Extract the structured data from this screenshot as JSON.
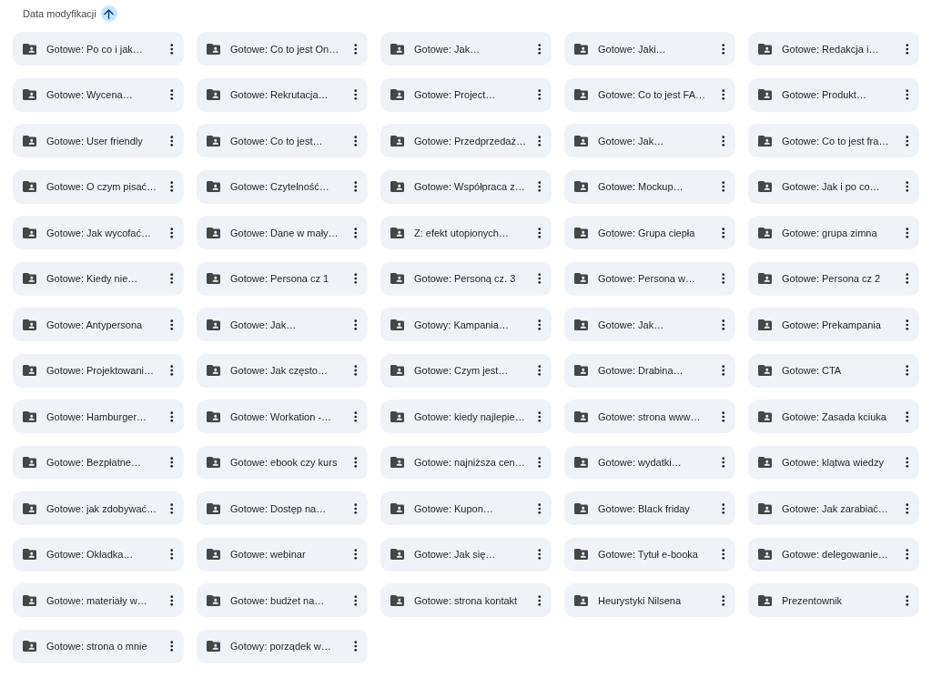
{
  "sort": {
    "label": "Data modyfikacji",
    "ascending": true
  },
  "folders": [
    {
      "name": "Gotowe: Po co i jak…"
    },
    {
      "name": "Gotowe: Co to jest On…"
    },
    {
      "name": "Gotowe: Jak…"
    },
    {
      "name": "Gotowe: Jaki…"
    },
    {
      "name": "Gotowe: Redakcja i…"
    },
    {
      "name": "Gotowe: Wycena…"
    },
    {
      "name": "Gotowe: Rekrutacja…"
    },
    {
      "name": "Gotowe: Project…"
    },
    {
      "name": "Gotowe: Co to jest FA…"
    },
    {
      "name": "Gotowe: Produkt…"
    },
    {
      "name": "Gotowe: User friendly"
    },
    {
      "name": "Gotowe: Co to jest…"
    },
    {
      "name": "Gotowe: Przedprzedaż…"
    },
    {
      "name": "Gotowe: Jak…"
    },
    {
      "name": "Gotowe: Co to jest fra…"
    },
    {
      "name": "Gotowe: O czym pisać…"
    },
    {
      "name": "Gotowe: Czytelność…"
    },
    {
      "name": "Gotowe: Współpraca z…"
    },
    {
      "name": "Gotowe: Mockup…"
    },
    {
      "name": "Gotowe: Jak i po co…"
    },
    {
      "name": "Gotowe: Jak wycofać…"
    },
    {
      "name": "Gotowe: Dane w mały…"
    },
    {
      "name": "Z: efekt utopionych…"
    },
    {
      "name": "Gotowe: Grupa ciepła"
    },
    {
      "name": "Gotowe: grupa zimna"
    },
    {
      "name": "Gotowe: Kiedy nie…"
    },
    {
      "name": "Gotowe: Persona cz 1"
    },
    {
      "name": "Gotowe: Personą cz. 3"
    },
    {
      "name": "Gotowe: Persona w…"
    },
    {
      "name": "Gotowe: Persona cz 2"
    },
    {
      "name": "Gotowe: Antypersona"
    },
    {
      "name": "Gotowe: Jak…"
    },
    {
      "name": "Gotowy: Kampania…"
    },
    {
      "name": "Gotowe: Jak…"
    },
    {
      "name": "Gotowe: Prekampania"
    },
    {
      "name": "Gotowe: Projektowani…"
    },
    {
      "name": "Gotowe: Jak często…"
    },
    {
      "name": "Gotowe: Czym jest…"
    },
    {
      "name": "Gotowe: Drabina…"
    },
    {
      "name": "Gotowe: CTA"
    },
    {
      "name": "Gotowe: Hamburger…"
    },
    {
      "name": "Gotowe: Workation -…"
    },
    {
      "name": "Gotowe: kiedy najlepie…"
    },
    {
      "name": "Gotowe: strona www…"
    },
    {
      "name": "Gotowe: Zasada kciuka"
    },
    {
      "name": "Gotowe: Bezpłatne…"
    },
    {
      "name": "Gotowe: ebook czy kurs"
    },
    {
      "name": "Gotowe: najniższa cen…"
    },
    {
      "name": "Gotowe: wydatki…"
    },
    {
      "name": "Gotowe: klątwa wiedzy"
    },
    {
      "name": "Gotowe: jak zdobywać…"
    },
    {
      "name": "Gotowe: Dostęp na…"
    },
    {
      "name": "Gotowe: Kupon…"
    },
    {
      "name": "Gotowe: Black friday"
    },
    {
      "name": "Gotowe: Jak zarabiać…"
    },
    {
      "name": "Gotowe: Okładka…"
    },
    {
      "name": "Gotowe: webinar"
    },
    {
      "name": "Gotowe: Jak się…"
    },
    {
      "name": "Gotowe: Tytuł e-booka"
    },
    {
      "name": "Gotowe: delegowanie…"
    },
    {
      "name": "Gotowe: materiały w…"
    },
    {
      "name": "Gotowe: budżet na…"
    },
    {
      "name": "Gotowe: strona kontakt"
    },
    {
      "name": "Heurystyki Nilsena"
    },
    {
      "name": "Prezentownik"
    },
    {
      "name": "Gotowe: strona o mnie"
    },
    {
      "name": "Gotowy: porządek w…"
    }
  ]
}
